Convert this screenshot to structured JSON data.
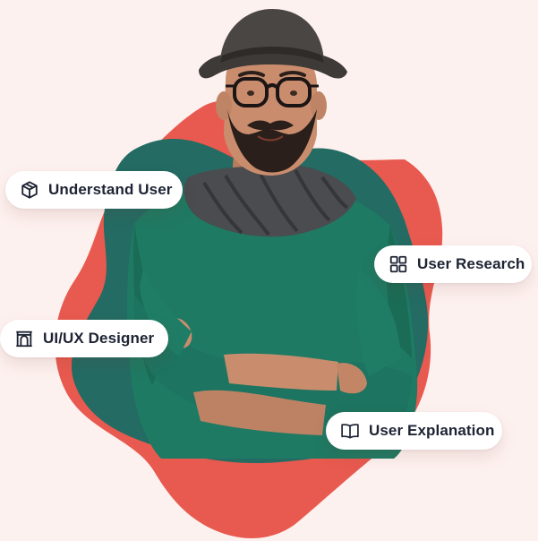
{
  "colors": {
    "background": "#fdf1ef",
    "blob_red": "#e85a4f",
    "blob_teal": "#236b63",
    "pill_background": "#ffffff",
    "pill_text": "#1d2333",
    "sweater": "#1e7a63",
    "scarf": "#4a4c4f",
    "hat": "#3d3a38",
    "skin": "#c98d6e",
    "beard": "#2a1f1a"
  },
  "badges": [
    {
      "label": "Understand User",
      "icon": "box-icon"
    },
    {
      "label": "User Research",
      "icon": "grid-icon"
    },
    {
      "label": "UI/UX Designer",
      "icon": "arch-icon"
    },
    {
      "label": "User Explanation",
      "icon": "book-icon"
    }
  ]
}
